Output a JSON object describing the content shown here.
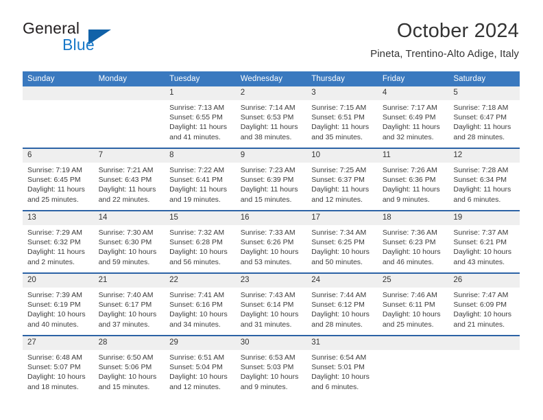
{
  "logo": {
    "primary_text": "General",
    "secondary_text": "Blue",
    "accent_color": "#1878c8",
    "triangle_color": "#1162a8"
  },
  "header": {
    "title": "October 2024",
    "subtitle": "Pineta, Trentino-Alto Adige, Italy"
  },
  "theme": {
    "header_bar_color": "#3a79bf",
    "row_divider_color": "#2b62a5",
    "daynum_strip_color": "#efefef",
    "text_color": "#333333"
  },
  "weekday_headers": [
    "Sunday",
    "Monday",
    "Tuesday",
    "Wednesday",
    "Thursday",
    "Friday",
    "Saturday"
  ],
  "labels": {
    "sunrise_prefix": "Sunrise:",
    "sunset_prefix": "Sunset:",
    "daylight_prefix": "Daylight:"
  },
  "weeks": [
    [
      {
        "day": "",
        "sunrise": "",
        "sunset": "",
        "daylight": ""
      },
      {
        "day": "",
        "sunrise": "",
        "sunset": "",
        "daylight": ""
      },
      {
        "day": "1",
        "sunrise": "Sunrise: 7:13 AM",
        "sunset": "Sunset: 6:55 PM",
        "daylight": "Daylight: 11 hours and 41 minutes."
      },
      {
        "day": "2",
        "sunrise": "Sunrise: 7:14 AM",
        "sunset": "Sunset: 6:53 PM",
        "daylight": "Daylight: 11 hours and 38 minutes."
      },
      {
        "day": "3",
        "sunrise": "Sunrise: 7:15 AM",
        "sunset": "Sunset: 6:51 PM",
        "daylight": "Daylight: 11 hours and 35 minutes."
      },
      {
        "day": "4",
        "sunrise": "Sunrise: 7:17 AM",
        "sunset": "Sunset: 6:49 PM",
        "daylight": "Daylight: 11 hours and 32 minutes."
      },
      {
        "day": "5",
        "sunrise": "Sunrise: 7:18 AM",
        "sunset": "Sunset: 6:47 PM",
        "daylight": "Daylight: 11 hours and 28 minutes."
      }
    ],
    [
      {
        "day": "6",
        "sunrise": "Sunrise: 7:19 AM",
        "sunset": "Sunset: 6:45 PM",
        "daylight": "Daylight: 11 hours and 25 minutes."
      },
      {
        "day": "7",
        "sunrise": "Sunrise: 7:21 AM",
        "sunset": "Sunset: 6:43 PM",
        "daylight": "Daylight: 11 hours and 22 minutes."
      },
      {
        "day": "8",
        "sunrise": "Sunrise: 7:22 AM",
        "sunset": "Sunset: 6:41 PM",
        "daylight": "Daylight: 11 hours and 19 minutes."
      },
      {
        "day": "9",
        "sunrise": "Sunrise: 7:23 AM",
        "sunset": "Sunset: 6:39 PM",
        "daylight": "Daylight: 11 hours and 15 minutes."
      },
      {
        "day": "10",
        "sunrise": "Sunrise: 7:25 AM",
        "sunset": "Sunset: 6:37 PM",
        "daylight": "Daylight: 11 hours and 12 minutes."
      },
      {
        "day": "11",
        "sunrise": "Sunrise: 7:26 AM",
        "sunset": "Sunset: 6:36 PM",
        "daylight": "Daylight: 11 hours and 9 minutes."
      },
      {
        "day": "12",
        "sunrise": "Sunrise: 7:28 AM",
        "sunset": "Sunset: 6:34 PM",
        "daylight": "Daylight: 11 hours and 6 minutes."
      }
    ],
    [
      {
        "day": "13",
        "sunrise": "Sunrise: 7:29 AM",
        "sunset": "Sunset: 6:32 PM",
        "daylight": "Daylight: 11 hours and 2 minutes."
      },
      {
        "day": "14",
        "sunrise": "Sunrise: 7:30 AM",
        "sunset": "Sunset: 6:30 PM",
        "daylight": "Daylight: 10 hours and 59 minutes."
      },
      {
        "day": "15",
        "sunrise": "Sunrise: 7:32 AM",
        "sunset": "Sunset: 6:28 PM",
        "daylight": "Daylight: 10 hours and 56 minutes."
      },
      {
        "day": "16",
        "sunrise": "Sunrise: 7:33 AM",
        "sunset": "Sunset: 6:26 PM",
        "daylight": "Daylight: 10 hours and 53 minutes."
      },
      {
        "day": "17",
        "sunrise": "Sunrise: 7:34 AM",
        "sunset": "Sunset: 6:25 PM",
        "daylight": "Daylight: 10 hours and 50 minutes."
      },
      {
        "day": "18",
        "sunrise": "Sunrise: 7:36 AM",
        "sunset": "Sunset: 6:23 PM",
        "daylight": "Daylight: 10 hours and 46 minutes."
      },
      {
        "day": "19",
        "sunrise": "Sunrise: 7:37 AM",
        "sunset": "Sunset: 6:21 PM",
        "daylight": "Daylight: 10 hours and 43 minutes."
      }
    ],
    [
      {
        "day": "20",
        "sunrise": "Sunrise: 7:39 AM",
        "sunset": "Sunset: 6:19 PM",
        "daylight": "Daylight: 10 hours and 40 minutes."
      },
      {
        "day": "21",
        "sunrise": "Sunrise: 7:40 AM",
        "sunset": "Sunset: 6:17 PM",
        "daylight": "Daylight: 10 hours and 37 minutes."
      },
      {
        "day": "22",
        "sunrise": "Sunrise: 7:41 AM",
        "sunset": "Sunset: 6:16 PM",
        "daylight": "Daylight: 10 hours and 34 minutes."
      },
      {
        "day": "23",
        "sunrise": "Sunrise: 7:43 AM",
        "sunset": "Sunset: 6:14 PM",
        "daylight": "Daylight: 10 hours and 31 minutes."
      },
      {
        "day": "24",
        "sunrise": "Sunrise: 7:44 AM",
        "sunset": "Sunset: 6:12 PM",
        "daylight": "Daylight: 10 hours and 28 minutes."
      },
      {
        "day": "25",
        "sunrise": "Sunrise: 7:46 AM",
        "sunset": "Sunset: 6:11 PM",
        "daylight": "Daylight: 10 hours and 25 minutes."
      },
      {
        "day": "26",
        "sunrise": "Sunrise: 7:47 AM",
        "sunset": "Sunset: 6:09 PM",
        "daylight": "Daylight: 10 hours and 21 minutes."
      }
    ],
    [
      {
        "day": "27",
        "sunrise": "Sunrise: 6:48 AM",
        "sunset": "Sunset: 5:07 PM",
        "daylight": "Daylight: 10 hours and 18 minutes."
      },
      {
        "day": "28",
        "sunrise": "Sunrise: 6:50 AM",
        "sunset": "Sunset: 5:06 PM",
        "daylight": "Daylight: 10 hours and 15 minutes."
      },
      {
        "day": "29",
        "sunrise": "Sunrise: 6:51 AM",
        "sunset": "Sunset: 5:04 PM",
        "daylight": "Daylight: 10 hours and 12 minutes."
      },
      {
        "day": "30",
        "sunrise": "Sunrise: 6:53 AM",
        "sunset": "Sunset: 5:03 PM",
        "daylight": "Daylight: 10 hours and 9 minutes."
      },
      {
        "day": "31",
        "sunrise": "Sunrise: 6:54 AM",
        "sunset": "Sunset: 5:01 PM",
        "daylight": "Daylight: 10 hours and 6 minutes."
      },
      {
        "day": "",
        "sunrise": "",
        "sunset": "",
        "daylight": ""
      },
      {
        "day": "",
        "sunrise": "",
        "sunset": "",
        "daylight": ""
      }
    ]
  ]
}
